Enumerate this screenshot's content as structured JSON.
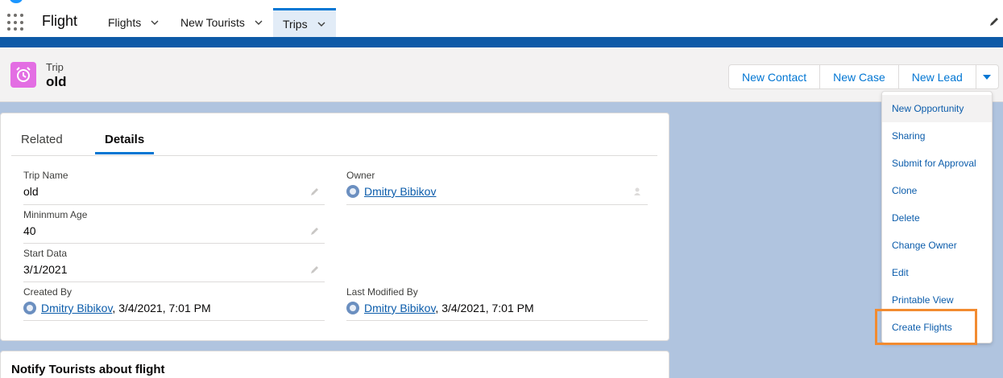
{
  "nav": {
    "app_name": "Flight",
    "tabs": [
      {
        "label": "Flights"
      },
      {
        "label": "New Tourists"
      },
      {
        "label": "Trips"
      }
    ]
  },
  "record": {
    "object_type": "Trip",
    "name": "old",
    "actions": [
      "New Contact",
      "New Case",
      "New Lead"
    ]
  },
  "detail_tabs": [
    "Related",
    "Details"
  ],
  "fields": {
    "trip_name": {
      "label": "Trip Name",
      "value": "old"
    },
    "owner": {
      "label": "Owner",
      "value": "Dmitry Bibikov"
    },
    "min_age": {
      "label": "Mininmum Age",
      "value": "40"
    },
    "start_data": {
      "label": "Start Data",
      "value": "3/1/2021"
    },
    "created_by": {
      "label": "Created By",
      "user": "Dmitry Bibikov",
      "date": ", 3/4/2021, 7:01 PM"
    },
    "last_modified_by": {
      "label": "Last Modified By",
      "user": "Dmitry Bibikov",
      "date": ", 3/4/2021, 7:01 PM"
    }
  },
  "notify_card": {
    "title": "Notify Tourists about flight"
  },
  "menu": {
    "items": [
      "New Opportunity",
      "Sharing",
      "Submit for Approval",
      "Clone",
      "Delete",
      "Change Owner",
      "Edit",
      "Printable View",
      "Create Flights"
    ]
  },
  "colors": {
    "brand": "#0176d3",
    "object_icon": "#e36ee3",
    "highlight": "#f28b30"
  }
}
